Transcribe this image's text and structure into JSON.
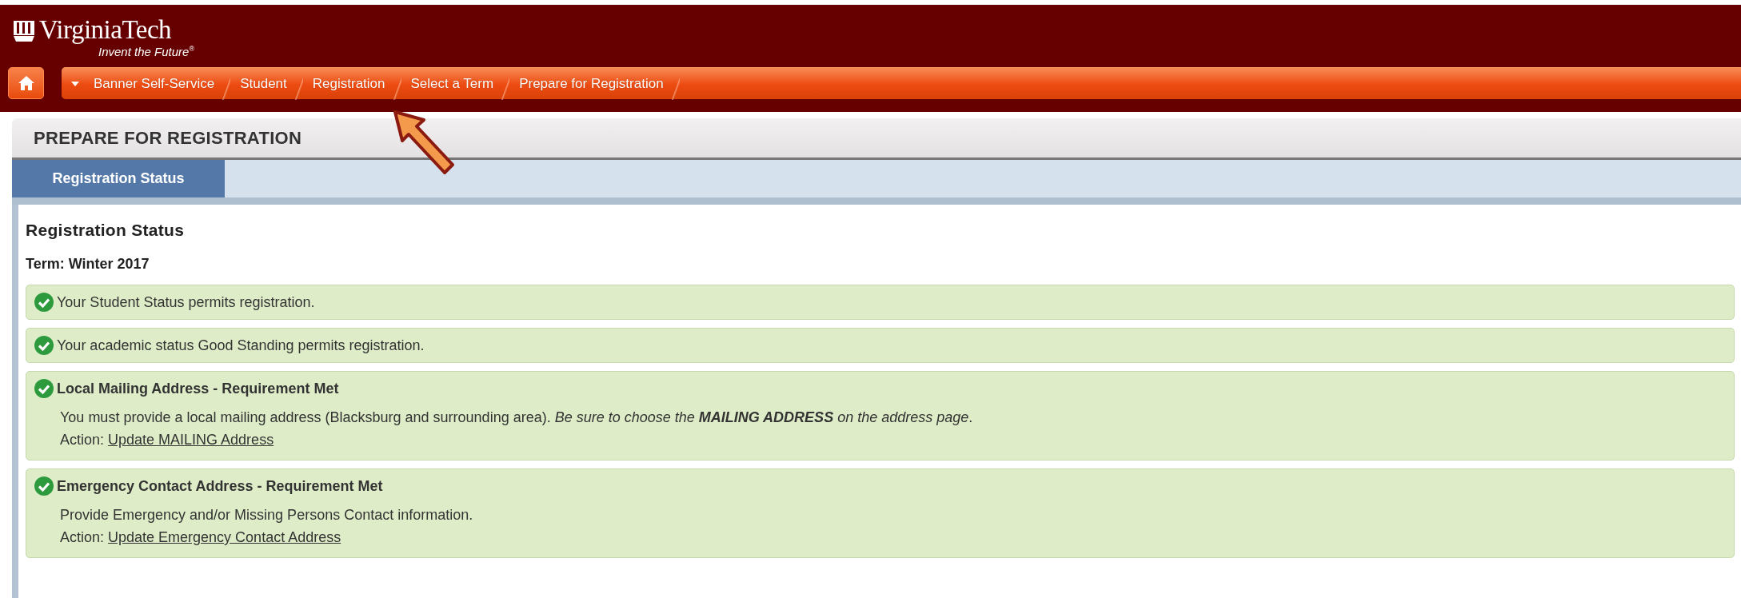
{
  "header": {
    "logo": "VirginiaTech",
    "tagline": "Invent the Future",
    "tagline_mark": "®"
  },
  "breadcrumbs": [
    "Banner Self-Service",
    "Student",
    "Registration",
    "Select a Term",
    "Prepare for Registration"
  ],
  "page_title": "PREPARE FOR REGISTRATION",
  "tabs": [
    {
      "label": "Registration Status",
      "selected": true
    }
  ],
  "panel": {
    "heading": "Registration Status",
    "term": "Term: Winter 2017",
    "items": [
      {
        "kind": "message",
        "met": true,
        "text": "Your Student Status permits registration."
      },
      {
        "kind": "message",
        "met": true,
        "text": "Your academic status Good Standing permits registration."
      },
      {
        "kind": "requirement",
        "met": true,
        "title": "Local Mailing Address - Requirement Met",
        "description": "You must provide a local mailing address (Blacksburg and surrounding area).",
        "note": "Be sure to choose the **MAILING ADDRESS** on the address page",
        "end": ".",
        "action_label": "Action:",
        "action_link": "Update MAILING Address"
      },
      {
        "kind": "requirement",
        "met": true,
        "title": "Emergency Contact Address - Requirement Met",
        "description": "Provide Emergency and/or Missing Persons Contact information.",
        "action_label": "Action:",
        "action_link": "Update Emergency Contact Address"
      }
    ]
  }
}
